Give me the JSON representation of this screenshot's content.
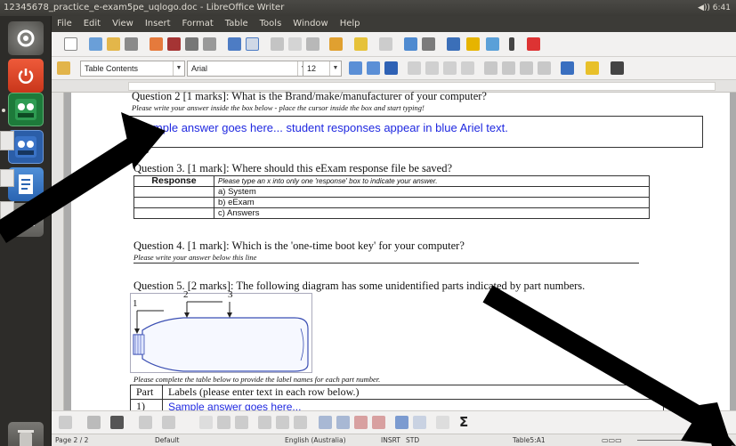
{
  "window": {
    "title": "12345678_practice_e-exam5pe_uqlogo.doc - LibreOffice Writer",
    "tray": "◀)) 6:41"
  },
  "menu": [
    "File",
    "Edit",
    "View",
    "Insert",
    "Format",
    "Table",
    "Tools",
    "Window",
    "Help"
  ],
  "toolbar": {
    "paragraph_style": "Table Contents",
    "font_name": "Arial",
    "font_size": "12"
  },
  "doc": {
    "q2_title": "Question 2 [1 marks]: What is the Brand/make/manufacturer of your computer?",
    "q2_instruction": "Please write your answer inside the box below - place the cursor inside the box and start typing!",
    "q2_answer": "Sample answer goes here... student responses appear in blue Ariel text.",
    "q3_title": "Question 3. [1 mark]: Where should this eExam response file be saved?",
    "q3_header": "Response",
    "q3_instruction": "Please type an x into only one 'response' box to indicate your answer.",
    "q3_options": [
      "a) System",
      "b) eExam",
      "c) Answers"
    ],
    "q4_title": "Question 4. [1 mark]: Which is the 'one-time boot key' for your computer?",
    "q4_instruction": "Please write your answer below this line",
    "q5_title": "Question 5. [2 marks]: The following diagram has some unidentified parts indicated by part numbers.",
    "q5_labels": [
      "1",
      "2",
      "3"
    ],
    "q5_instruction": "Please complete the table below to provide the label names for each part number.",
    "parts_header": [
      "Part",
      "Labels (please enter text in each row below.)"
    ],
    "parts_row1": [
      "1)",
      "Sample answer goes here..."
    ]
  },
  "status": {
    "page": "Page 2 / 2",
    "style": "Default",
    "language": "English (Australia)",
    "mode": "INSRT",
    "selection": "STD",
    "cell": "Table5:A1"
  },
  "bottom_toolbar": {
    "sum_symbol": "Σ"
  }
}
